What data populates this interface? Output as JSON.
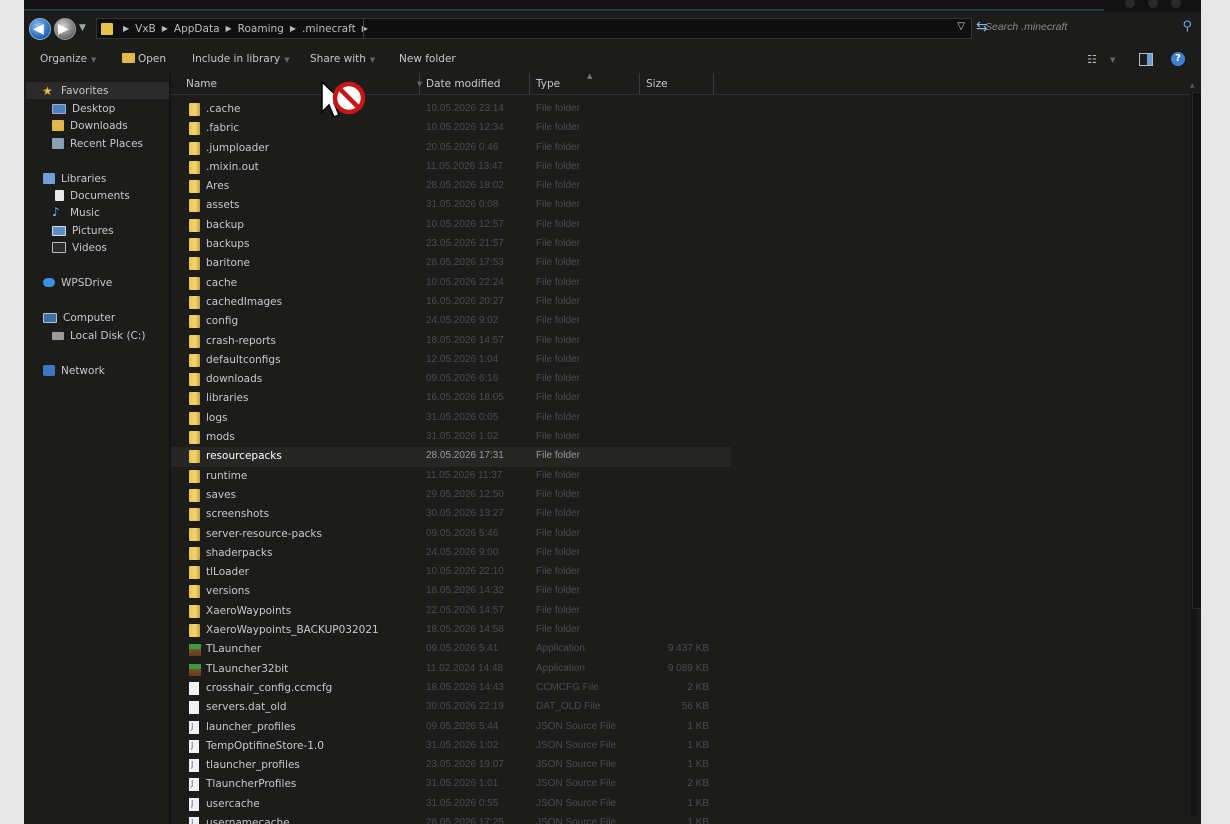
{
  "address": {
    "crumbs": [
      "VxB",
      "AppData",
      "Roaming",
      ".minecraft"
    ],
    "search_placeholder": "Search .minecraft"
  },
  "toolbar": {
    "organize": "Organize",
    "open": "Open",
    "include": "Include in library",
    "share": "Share with",
    "new_folder": "New folder"
  },
  "nav": {
    "favorites": "Favorites",
    "desktop": "Desktop",
    "downloads": "Downloads",
    "recent": "Recent Places",
    "libraries": "Libraries",
    "documents": "Documents",
    "music": "Music",
    "pictures": "Pictures",
    "videos": "Videos",
    "wpsdrive": "WPSDrive",
    "computer": "Computer",
    "localdisk": "Local Disk (C:)",
    "network": "Network"
  },
  "columns": {
    "name": "Name",
    "date": "Date modified",
    "type": "Type",
    "size": "Size"
  },
  "files": [
    {
      "name": ".cache",
      "date": "10.05.2026 23:14",
      "type": "File folder",
      "size": "",
      "icon": "folder-icon"
    },
    {
      "name": ".fabric",
      "date": "10.05.2026 12:34",
      "type": "File folder",
      "size": "",
      "icon": "folder-icon"
    },
    {
      "name": ".jumploader",
      "date": "20.05.2026 0:46",
      "type": "File folder",
      "size": "",
      "icon": "folder-icon"
    },
    {
      "name": ".mixin.out",
      "date": "11.05.2026 13:47",
      "type": "File folder",
      "size": "",
      "icon": "folder-icon"
    },
    {
      "name": "Ares",
      "date": "28.05.2026 18:02",
      "type": "File folder",
      "size": "",
      "icon": "folder-icon"
    },
    {
      "name": "assets",
      "date": "31.05.2026 0:08",
      "type": "File folder",
      "size": "",
      "icon": "folder-icon"
    },
    {
      "name": "backup",
      "date": "10.05.2026 12:57",
      "type": "File folder",
      "size": "",
      "icon": "folder-icon"
    },
    {
      "name": "backups",
      "date": "23.05.2026 21:57",
      "type": "File folder",
      "size": "",
      "icon": "folder-icon"
    },
    {
      "name": "baritone",
      "date": "28.05.2026 17:53",
      "type": "File folder",
      "size": "",
      "icon": "folder-icon"
    },
    {
      "name": "cache",
      "date": "10.05.2026 22:24",
      "type": "File folder",
      "size": "",
      "icon": "folder-icon"
    },
    {
      "name": "cachedImages",
      "date": "16.05.2026 20:27",
      "type": "File folder",
      "size": "",
      "icon": "folder-icon"
    },
    {
      "name": "config",
      "date": "24.05.2026 9:02",
      "type": "File folder",
      "size": "",
      "icon": "folder-icon"
    },
    {
      "name": "crash-reports",
      "date": "18.05.2026 14:57",
      "type": "File folder",
      "size": "",
      "icon": "folder-icon"
    },
    {
      "name": "defaultconfigs",
      "date": "12.05.2026 1:04",
      "type": "File folder",
      "size": "",
      "icon": "folder-icon"
    },
    {
      "name": "downloads",
      "date": "09.05.2026 6:16",
      "type": "File folder",
      "size": "",
      "icon": "folder-icon"
    },
    {
      "name": "libraries",
      "date": "16.05.2026 18:05",
      "type": "File folder",
      "size": "",
      "icon": "folder-icon"
    },
    {
      "name": "logs",
      "date": "31.05.2026 0:05",
      "type": "File folder",
      "size": "",
      "icon": "folder-icon"
    },
    {
      "name": "mods",
      "date": "31.05.2026 1:02",
      "type": "File folder",
      "size": "",
      "icon": "folder-icon"
    },
    {
      "name": "resourcepacks",
      "date": "28.05.2026 17:31",
      "type": "File folder",
      "size": "",
      "icon": "folder-icon",
      "selected": true
    },
    {
      "name": "runtime",
      "date": "11.05.2026 11:37",
      "type": "File folder",
      "size": "",
      "icon": "folder-icon"
    },
    {
      "name": "saves",
      "date": "29.05.2026 12:50",
      "type": "File folder",
      "size": "",
      "icon": "folder-icon"
    },
    {
      "name": "screenshots",
      "date": "30.05.2026 13:27",
      "type": "File folder",
      "size": "",
      "icon": "folder-icon"
    },
    {
      "name": "server-resource-packs",
      "date": "09.05.2026 5:46",
      "type": "File folder",
      "size": "",
      "icon": "folder-icon"
    },
    {
      "name": "shaderpacks",
      "date": "24.05.2026 9:00",
      "type": "File folder",
      "size": "",
      "icon": "folder-icon"
    },
    {
      "name": "tlLoader",
      "date": "10.05.2026 22:10",
      "type": "File folder",
      "size": "",
      "icon": "folder-icon"
    },
    {
      "name": "versions",
      "date": "18.05.2026 14:32",
      "type": "File folder",
      "size": "",
      "icon": "folder-icon"
    },
    {
      "name": "XaeroWaypoints",
      "date": "22.05.2026 14:57",
      "type": "File folder",
      "size": "",
      "icon": "folder-icon"
    },
    {
      "name": "XaeroWaypoints_BACKUP032021",
      "date": "18.05.2026 14:58",
      "type": "File folder",
      "size": "",
      "icon": "folder-icon"
    },
    {
      "name": "TLauncher",
      "date": "09.05.2026 5:41",
      "type": "Application",
      "size": "9 437 KB",
      "icon": "tlauncher-app-icon"
    },
    {
      "name": "TLauncher32bit",
      "date": "11.02.2024 14:48",
      "type": "Application",
      "size": "9 089 KB",
      "icon": "tlauncher-app-icon"
    },
    {
      "name": "crosshair_config.ccmcfg",
      "date": "18.05.2026 14:43",
      "type": "CCMCFG File",
      "size": "2 KB",
      "icon": "file-icon"
    },
    {
      "name": "servers.dat_old",
      "date": "30.05.2026 22:19",
      "type": "DAT_OLD File",
      "size": "56 KB",
      "icon": "file-icon"
    },
    {
      "name": "launcher_profiles",
      "date": "09.05.2026 5:44",
      "type": "JSON Source File",
      "size": "1 KB",
      "icon": "json-file-icon"
    },
    {
      "name": "TempOptifineStore-1.0",
      "date": "31.05.2026 1:02",
      "type": "JSON Source File",
      "size": "1 KB",
      "icon": "json-file-icon"
    },
    {
      "name": "tlauncher_profiles",
      "date": "23.05.2026 19:07",
      "type": "JSON Source File",
      "size": "1 KB",
      "icon": "json-file-icon"
    },
    {
      "name": "TlauncherProfiles",
      "date": "31.05.2026 1:01",
      "type": "JSON Source File",
      "size": "2 KB",
      "icon": "json-file-icon"
    },
    {
      "name": "usercache",
      "date": "31.05.2026 0:55",
      "type": "JSON Source File",
      "size": "1 KB",
      "icon": "json-file-icon"
    },
    {
      "name": "usernamecache",
      "date": "28.05.2026 17:25",
      "type": "JSON Source File",
      "size": "1 KB",
      "icon": "json-file-icon"
    }
  ],
  "colors": {
    "background": "#1c1d1b",
    "text": "#c8c8c8",
    "folder": "#e9c24f",
    "no_drop_cursor": "#d11a1a"
  }
}
